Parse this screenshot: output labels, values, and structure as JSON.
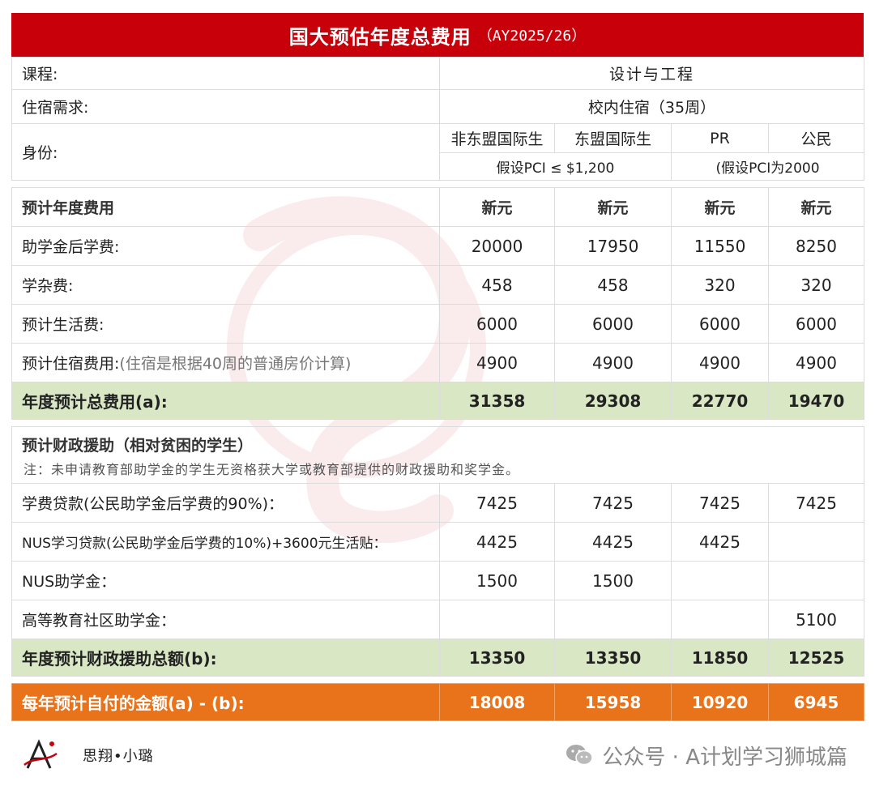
{
  "title": {
    "main": "国大预估年度总费用",
    "sub": "（AY2025/26）"
  },
  "info": {
    "course_label": "课程:",
    "course_value": "设计与工程",
    "housing_label": "住宿需求:",
    "housing_value": "校内住宿（35周）",
    "identity_label": "身份:",
    "identity_cols": [
      "非东盟国际生",
      "东盟国际生",
      "PR",
      "公民"
    ],
    "pci_left": "假设PCI ≤ $1,200",
    "pci_right": "(假设PCI为2000"
  },
  "costs": {
    "header": "预计年度费用",
    "currency": [
      "新元",
      "新元",
      "新元",
      "新元"
    ],
    "rows": [
      {
        "label": "助学金后学费:",
        "note": "",
        "values": [
          "20000",
          "17950",
          "11550",
          "8250"
        ]
      },
      {
        "label": "学杂费:",
        "note": "",
        "values": [
          "458",
          "458",
          "320",
          "320"
        ]
      },
      {
        "label": "预计生活费:",
        "note": "",
        "values": [
          "6000",
          "6000",
          "6000",
          "6000"
        ]
      },
      {
        "label": "预计住宿费用:",
        "note": "(住宿是根据40周的普通房价计算)",
        "values": [
          "4900",
          "4900",
          "4900",
          "4900"
        ]
      }
    ],
    "total_label": "年度预计总费用(a):",
    "total_values": [
      "31358",
      "29308",
      "22770",
      "19470"
    ]
  },
  "aid": {
    "header": "预计财政援助（相对贫困的学生）",
    "note": "注：未申请教育部助学金的学生无资格获大学或教育部提供的财政援助和奖学金。",
    "rows": [
      {
        "label": "学费贷款(公民助学金后学费的90%)：",
        "values": [
          "7425",
          "7425",
          "7425",
          "7425"
        ]
      },
      {
        "label": "NUS学习贷款(公民助学金后学费的10%)+3600元生活贴：",
        "values": [
          "4425",
          "4425",
          "4425",
          ""
        ]
      },
      {
        "label": "NUS助学金：",
        "values": [
          "1500",
          "1500",
          "",
          ""
        ]
      },
      {
        "label": "高等教育社区助学金：",
        "values": [
          "",
          "",
          "",
          "5100"
        ]
      }
    ],
    "total_label": "年度预计财政援助总额(b):",
    "total_values": [
      "13350",
      "13350",
      "11850",
      "12525"
    ]
  },
  "net": {
    "label": "每年预计自付的金额(a) - (b):",
    "values": [
      "18008",
      "15958",
      "10920",
      "6945"
    ]
  },
  "footer": {
    "brand": "思翔•小璐",
    "wechat": "公众号 · A计划学习狮城篇"
  },
  "colors": {
    "title_bg": "#c8000a",
    "total_bg": "#d9e7c4",
    "net_bg": "#e8731a"
  }
}
